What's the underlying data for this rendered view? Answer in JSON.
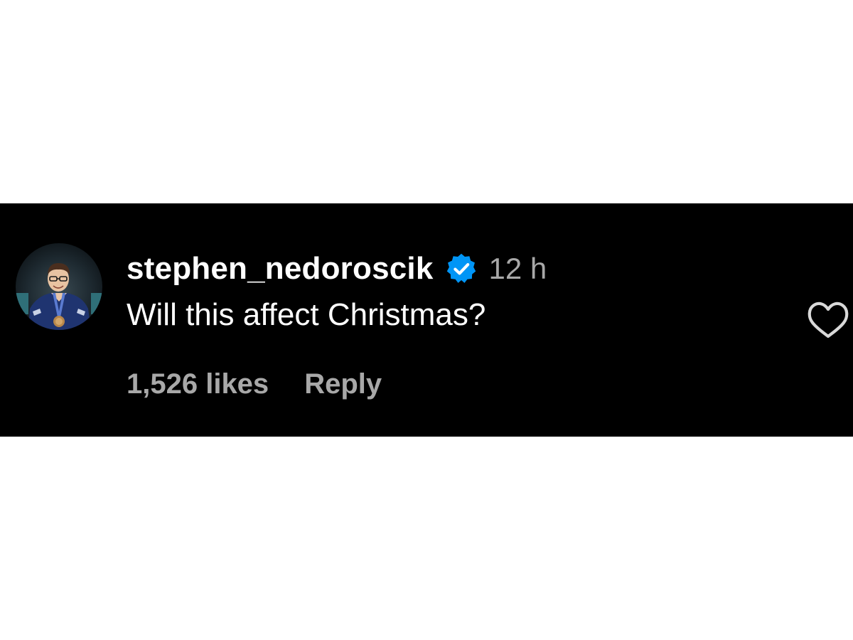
{
  "comment": {
    "username": "stephen_nedoroscik",
    "verified_icon": "verified-badge-icon",
    "timestamp": "12 h",
    "text": "Will this affect Christmas?",
    "likes": "1,526 likes",
    "reply_label": "Reply",
    "like_icon": "heart-outline-icon",
    "avatar_icon": "profile-avatar"
  },
  "colors": {
    "background": "#000000",
    "page_background": "#ffffff",
    "text_primary": "#ffffff",
    "text_secondary": "#a8a8a8",
    "verified_blue": "#0095f6"
  }
}
